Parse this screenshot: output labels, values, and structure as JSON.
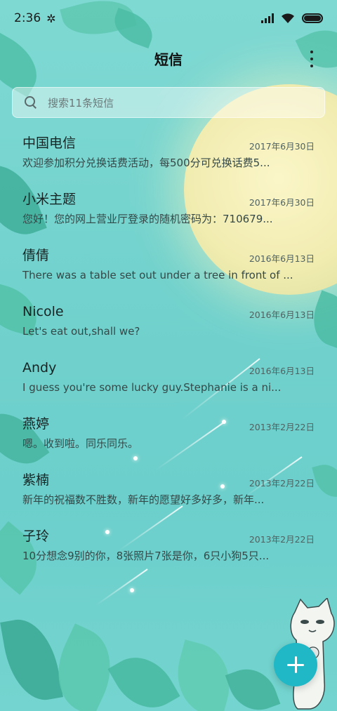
{
  "status_bar": {
    "time": "2:36",
    "bluetooth_icon": "bluetooth-icon",
    "signal_icon": "signal-icon",
    "wifi_icon": "wifi-icon",
    "battery_icon": "battery-icon"
  },
  "header": {
    "title": "短信",
    "more_icon": "more-vertical-icon"
  },
  "search": {
    "placeholder": "搜索11条短信",
    "icon": "search-icon"
  },
  "conversations": [
    {
      "name": "中国电信",
      "date": "2017年6月30日",
      "preview": "欢迎参加积分兑换话费活动，每500分可兑换话费5..."
    },
    {
      "name": "小米主题",
      "date": "2017年6月30日",
      "preview": "您好！您的网上营业厅登录的随机密码为：710679..."
    },
    {
      "name": "倩倩",
      "date": "2016年6月13日",
      "preview": "There was a table set out under a tree in front of ..."
    },
    {
      "name": "Nicole",
      "date": "2016年6月13日",
      "preview": "Let's eat out,shall we?"
    },
    {
      "name": "Andy",
      "date": "2016年6月13日",
      "preview": "I guess you're some lucky guy.Stephanie is a ni..."
    },
    {
      "name": "燕婷",
      "date": "2013年2月22日",
      "preview": "嗯。收到啦。同乐同乐。"
    },
    {
      "name": "紫楠",
      "date": "2013年2月22日",
      "preview": "新年的祝福数不胜数，新年的愿望好多好多，新年..."
    },
    {
      "name": "子玲",
      "date": "2013年2月22日",
      "preview": "10分想念9别的你，8张照片7张是你，6只小狗5只..."
    }
  ],
  "fab": {
    "icon": "plus-icon"
  },
  "theme": {
    "background": "#6fd3cf",
    "accent": "#20b8c6"
  }
}
